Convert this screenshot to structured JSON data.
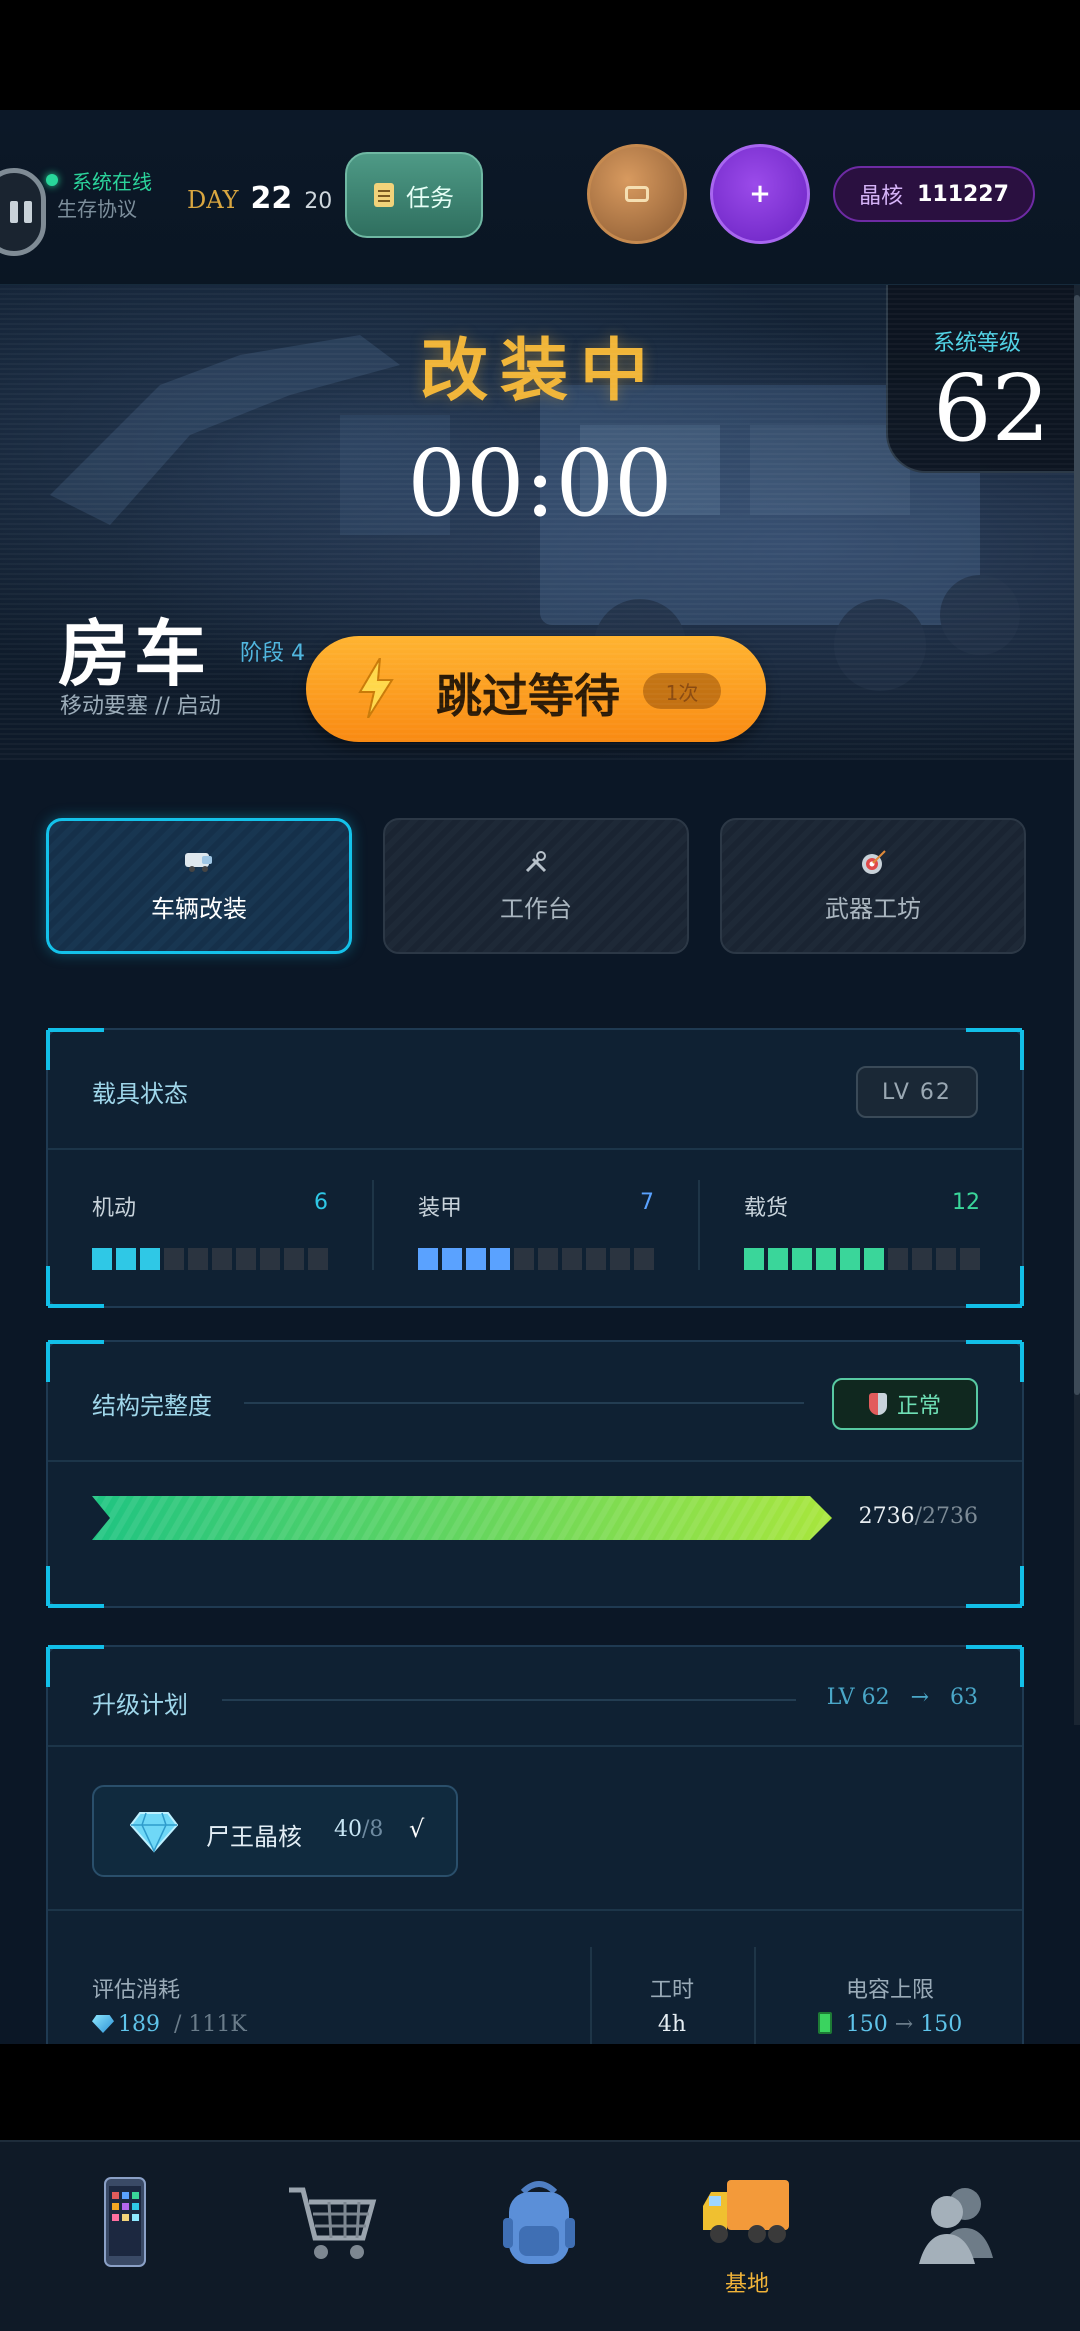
{
  "topbar": {
    "status_online": "系统在线",
    "status_protocol": "生存协议",
    "day_label": "DAY",
    "day_number": "22",
    "day_sub": "20",
    "task_label": "任务",
    "plus_label": "+",
    "crystal_label": "晶核",
    "crystal_value": "111227"
  },
  "hero": {
    "title": "改装中",
    "timer": "00:00",
    "timer_progress": 0.5,
    "system_level_label": "系统等级",
    "system_level_value": "62",
    "vehicle_name": "房车",
    "stage": "阶段 4",
    "vehicle_sub": "移动要塞 // 启动",
    "skip_label": "跳过等待",
    "skip_count": "1次"
  },
  "tabs": [
    {
      "label": "车辆改装",
      "icon": "van-icon",
      "active": true
    },
    {
      "label": "工作台",
      "icon": "tools-icon",
      "active": false
    },
    {
      "label": "武器工坊",
      "icon": "target-icon",
      "active": false
    }
  ],
  "vehicle_status": {
    "title": "载具状态",
    "level": "LV 62",
    "stats": [
      {
        "name": "机动",
        "value": "6",
        "filled": 3,
        "color": "#2fc8e6"
      },
      {
        "name": "装甲",
        "value": "7",
        "filled": 4,
        "color": "#5aa2ff"
      },
      {
        "name": "载货",
        "value": "12",
        "filled": 6,
        "color": "#3ad69a"
      }
    ]
  },
  "integrity": {
    "title": "结构完整度",
    "status": "正常",
    "current": "2736",
    "max": "/2736",
    "fraction": 1.0
  },
  "upgrade": {
    "title": "升级计划",
    "from_level": "LV 62",
    "arrow": "→",
    "to_level": "63",
    "material_name": "尸王晶核",
    "material_have": "40",
    "material_need": "/8",
    "material_ok": "√",
    "cost_label": "评估消耗",
    "cost_crystal": "189",
    "cost_total": "/ 111K",
    "time_label": "工时",
    "time_value": "4h",
    "capacity_label": "电容上限",
    "capacity_from": "150",
    "capacity_arrow": "→",
    "capacity_to": "150"
  },
  "bottom_nav": [
    {
      "icon": "phone-icon",
      "label": ""
    },
    {
      "icon": "cart-icon",
      "label": ""
    },
    {
      "icon": "backpack-icon",
      "label": ""
    },
    {
      "icon": "truck-icon",
      "label": "基地"
    },
    {
      "icon": "profile-icon",
      "label": ""
    }
  ],
  "colors": {
    "accent_cyan": "#14c2ea",
    "accent_orange": "#f5a623",
    "background": "#0b1726"
  }
}
